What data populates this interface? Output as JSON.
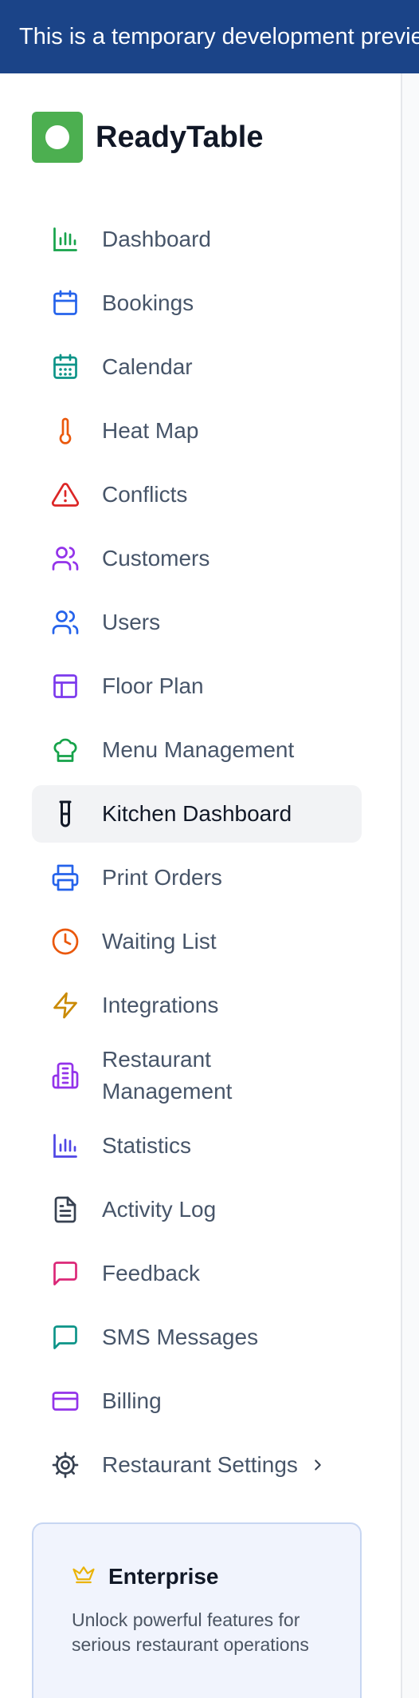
{
  "banner": {
    "text": "This is a temporary development preview"
  },
  "brand": {
    "name": "ReadyTable",
    "color": "#4caf50"
  },
  "nav": {
    "items": [
      {
        "label": "Dashboard",
        "icon": "bar-chart-icon",
        "color": "#16a34a"
      },
      {
        "label": "Bookings",
        "icon": "calendar-icon",
        "color": "#2563eb"
      },
      {
        "label": "Calendar",
        "icon": "calendar-grid-icon",
        "color": "#0d9488"
      },
      {
        "label": "Heat Map",
        "icon": "thermometer-icon",
        "color": "#ea580c"
      },
      {
        "label": "Conflicts",
        "icon": "warning-triangle-icon",
        "color": "#dc2626"
      },
      {
        "label": "Customers",
        "icon": "users-icon",
        "color": "#9333ea"
      },
      {
        "label": "Users",
        "icon": "users-icon",
        "color": "#2563eb"
      },
      {
        "label": "Floor Plan",
        "icon": "layout-icon",
        "color": "#7c3aed"
      },
      {
        "label": "Menu Management",
        "icon": "chef-hat-icon",
        "color": "#16a34a"
      },
      {
        "label": "Kitchen Dashboard",
        "icon": "utensil-icon",
        "color": "#111827",
        "active": true
      },
      {
        "label": "Print Orders",
        "icon": "printer-icon",
        "color": "#2563eb"
      },
      {
        "label": "Waiting List",
        "icon": "clock-icon",
        "color": "#ea580c"
      },
      {
        "label": "Integrations",
        "icon": "lightning-icon",
        "color": "#ca8a04"
      },
      {
        "label": "Restaurant Management",
        "icon": "building-icon",
        "color": "#9333ea"
      },
      {
        "label": "Statistics",
        "icon": "bar-chart-icon",
        "color": "#4f46e5"
      },
      {
        "label": "Activity Log",
        "icon": "document-icon",
        "color": "#374151"
      },
      {
        "label": "Feedback",
        "icon": "message-icon",
        "color": "#db2777"
      },
      {
        "label": "SMS Messages",
        "icon": "message-icon",
        "color": "#0d9488"
      },
      {
        "label": "Billing",
        "icon": "credit-card-icon",
        "color": "#9333ea"
      },
      {
        "label": "Restaurant Settings",
        "icon": "gear-icon",
        "color": "#374151",
        "has_submenu": true
      }
    ]
  },
  "promo": {
    "title": "Enterprise",
    "icon": "crown-icon",
    "description": "Unlock powerful features for serious restaurant operations",
    "accent": "#eab308"
  }
}
